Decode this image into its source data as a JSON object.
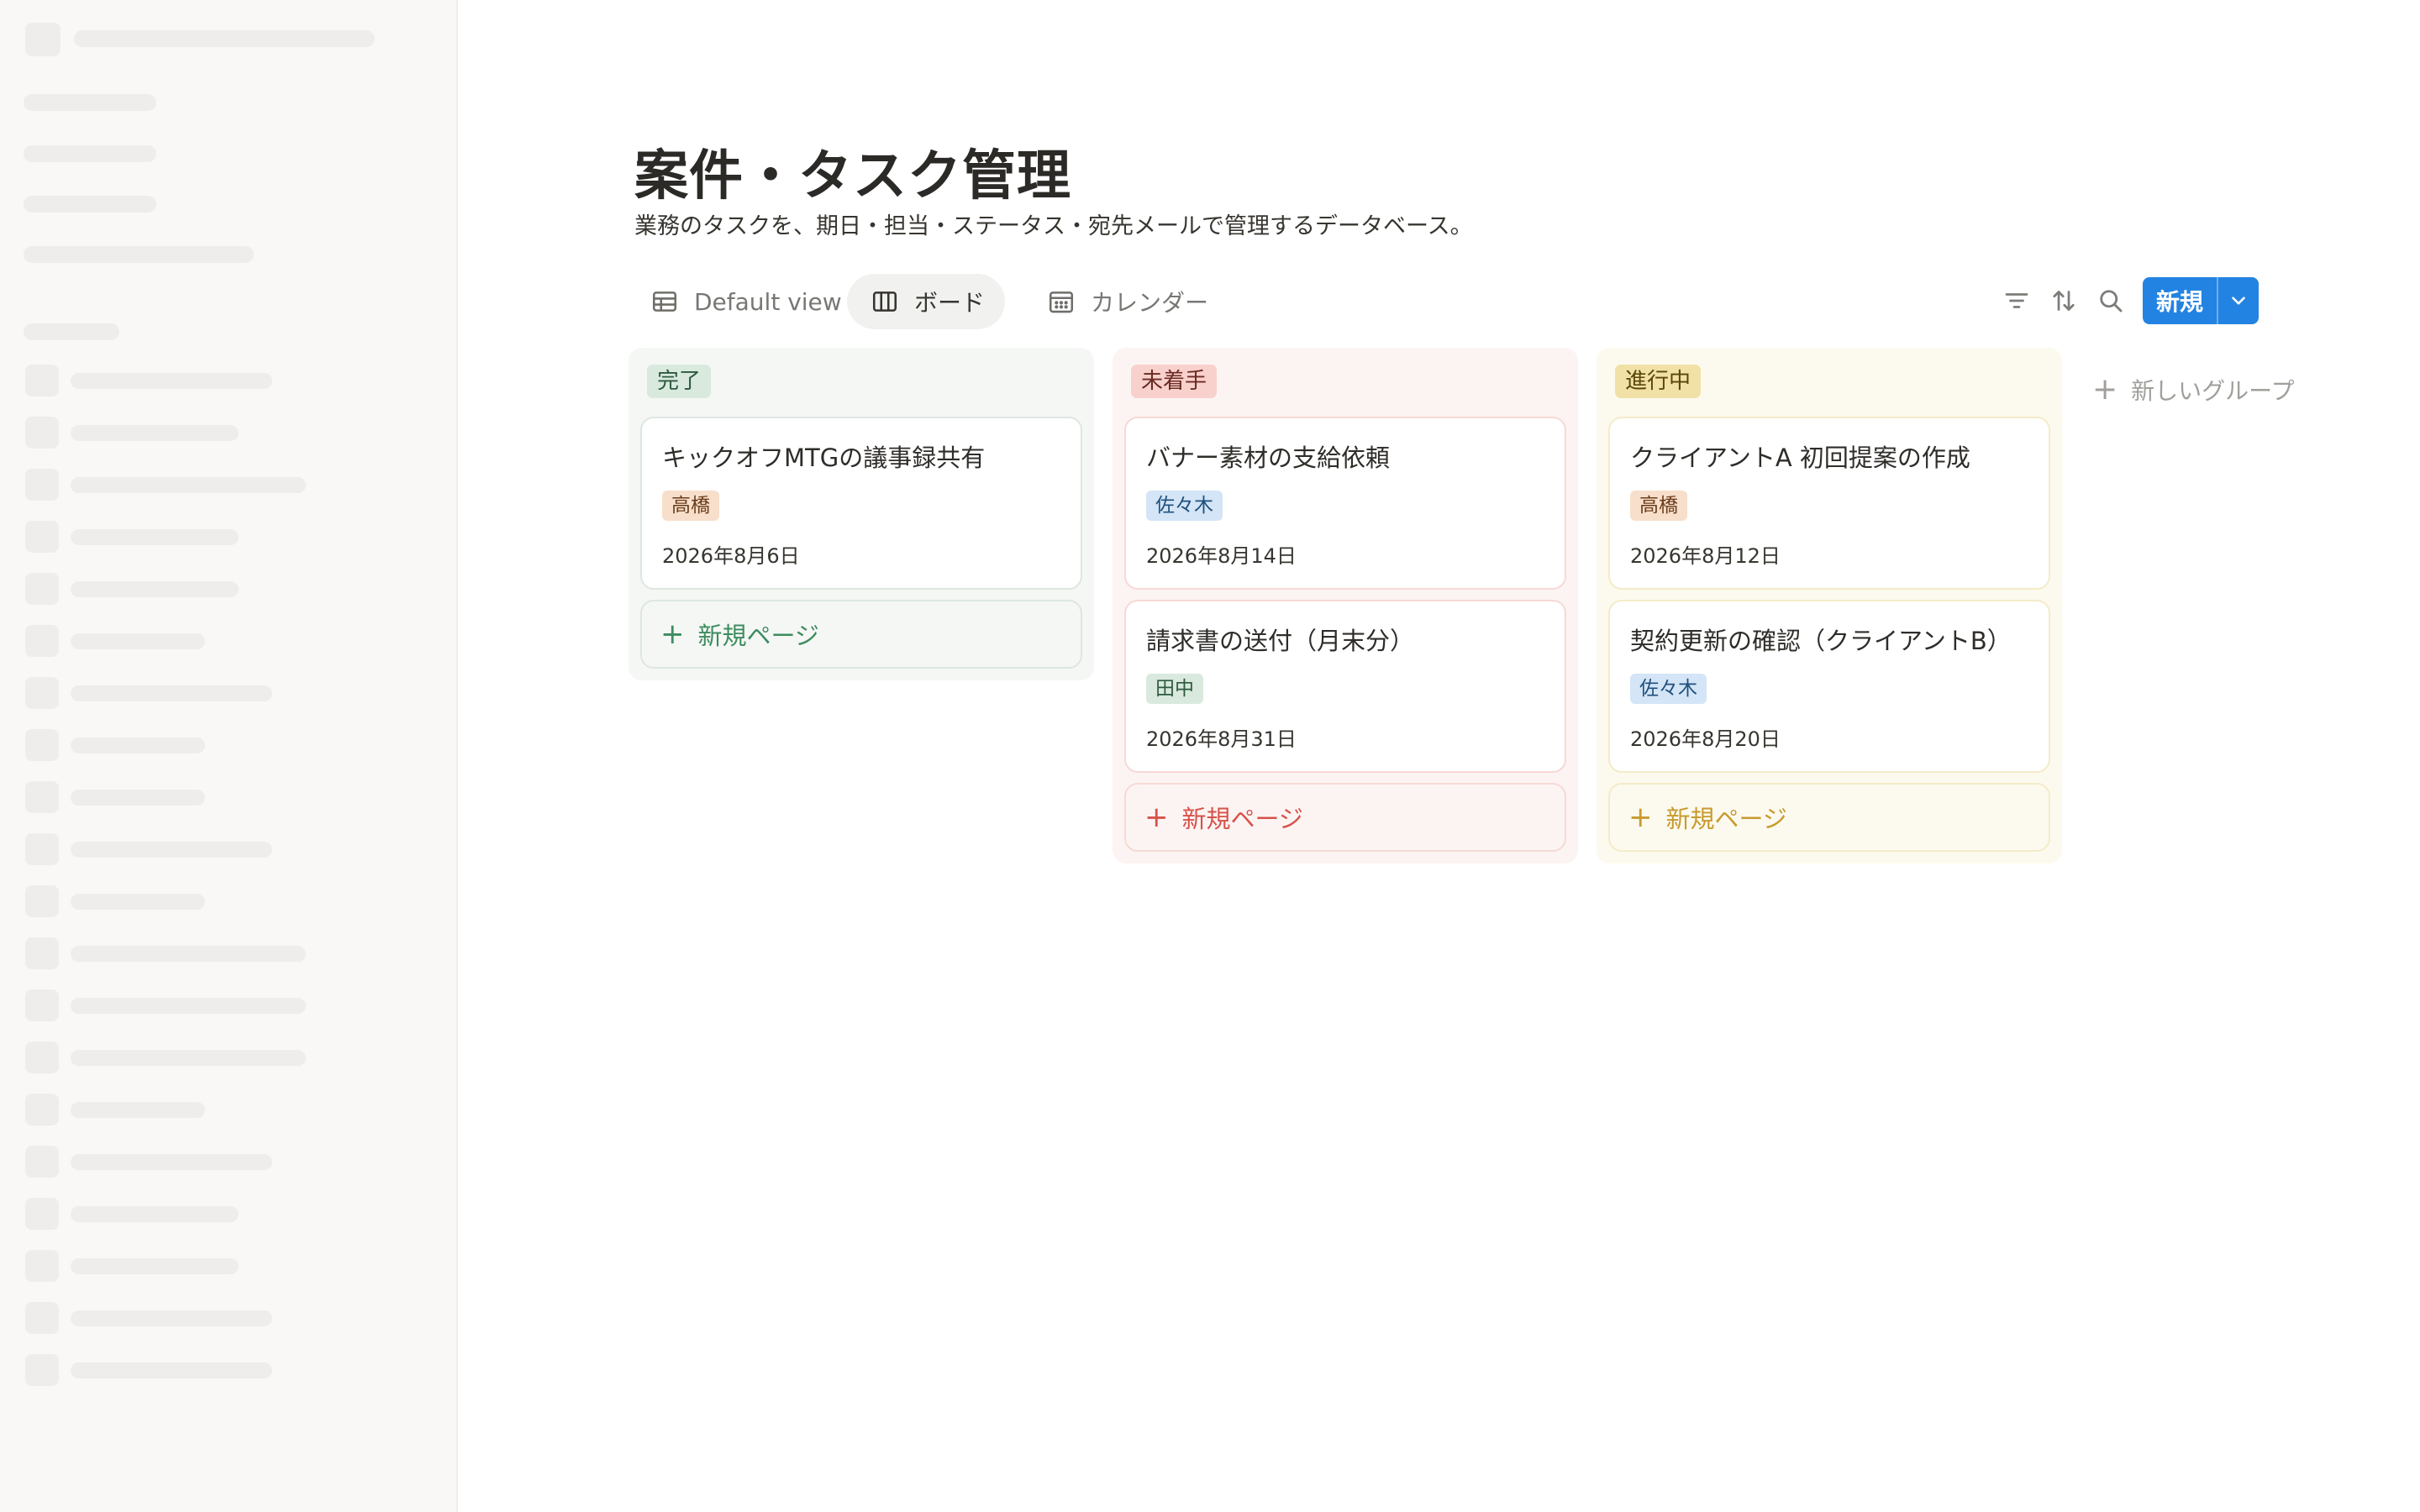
{
  "page": {
    "title": "案件・タスク管理",
    "description": "業務のタスクを、期日・担当・ステータス・宛先メールで管理するデータベース。"
  },
  "views": [
    {
      "label": "Default view",
      "icon": "table-icon",
      "active": false
    },
    {
      "label": "ボード",
      "icon": "board-icon",
      "active": true
    },
    {
      "label": "カレンダー",
      "icon": "calendar-icon",
      "active": false
    }
  ],
  "toolbar": {
    "filter_icon": "filter-icon",
    "sort_icon": "sort-icon",
    "search_icon": "search-icon",
    "new_label": "新規"
  },
  "groups": [
    {
      "status": "完了",
      "cards": [
        {
          "title": "キックオフMTGの議事録共有",
          "assignee": "高橋",
          "date": "2026年8月6日"
        }
      ],
      "add_label": "新規ページ"
    },
    {
      "status": "未着手",
      "cards": [
        {
          "title": "バナー素材の支給依頼",
          "assignee": "佐々木",
          "date": "2026年8月14日"
        },
        {
          "title": "請求書の送付（月末分）",
          "assignee": "田中",
          "date": "2026年8月31日"
        }
      ],
      "add_label": "新規ページ"
    },
    {
      "status": "進行中",
      "cards": [
        {
          "title": "クライアントA 初回提案の作成",
          "assignee": "高橋",
          "date": "2026年8月12日"
        },
        {
          "title": "契約更新の確認（クライアントB）",
          "assignee": "佐々木",
          "date": "2026年8月20日"
        }
      ],
      "add_label": "新規ページ"
    }
  ],
  "new_group_label": "新しいグループ",
  "colors": {
    "accent": "#2383e2",
    "status_done": "#d9e9de",
    "status_todo": "#f9d1cc",
    "status_doing": "#f1e1a6"
  }
}
